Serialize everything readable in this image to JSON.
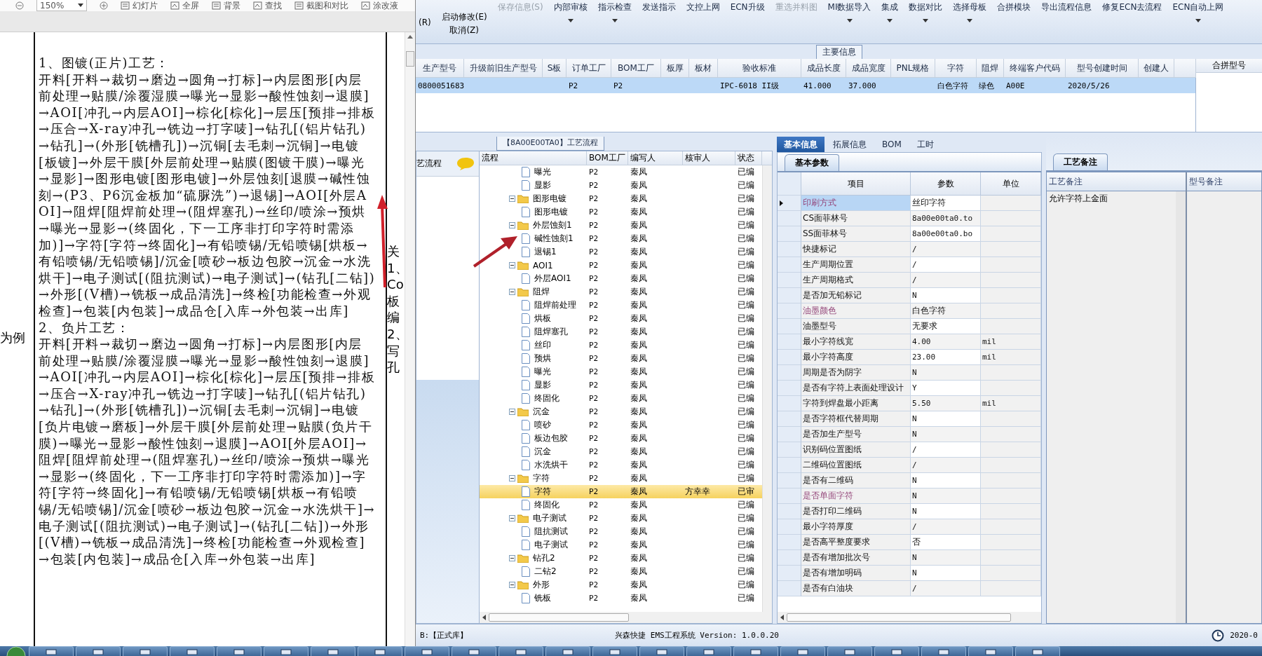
{
  "viewer": {
    "zoom": "150%",
    "tools": [
      "幻灯片",
      "全屏",
      "背景",
      "查找",
      "截图和对比",
      "涂改液"
    ],
    "left_margin": "为例",
    "paragraphs": [
      "1、图镀(正片)工艺：",
      "开料[开料→裁切→磨边→圆角→打标]→内层图形[内层前处理→贴膜/涂覆湿膜→曝光→显影→酸性蚀刻→退膜]→AOI[冲孔→内层AOI]→棕化[棕化]→层压[预排→排板→压合→X-ray冲孔→铣边→打字唛]→钻孔[(铝片钻孔)→钻孔]→(外形[铣槽孔])→沉铜[去毛刺→沉铜]→电镀[板镀]→外层干膜[外层前处理→贴膜(图镀干膜)→曝光→显影]→图形电镀[图形电镀]→外层蚀刻[退膜→碱性蚀刻→(P3、P6沉金板加“硫脲洗”)→退锡]→AOI[外层AOI]→阻焊[阻焊前处理→(阻焊塞孔)→丝印/喷涂→预烘→曝光→显影→(终固化，下一工序非打印字符时需添加)]→字符[字符→终固化]→有铅喷锡/无铅喷锡[烘板→有铅喷锡/无铅喷锡]/沉金[喷砂→板边包胶→沉金→水洗烘干]→电子测试[(阻抗测试)→电子测试]→(钻孔[二钻])→外形[(V槽)→铣板→成品清洗]→终检[功能检查→外观检查]→包装[内包装]→成品仓[入库→外包装→出库]",
      "2、负片工艺：",
      "开料[开料→裁切→磨边→圆角→打标]→内层图形[内层前处理→贴膜/涂覆湿膜→曝光→显影→酸性蚀刻→退膜]→AOI[冲孔→内层AOI]→棕化[棕化]→层压[预排→排板→压合→X-ray冲孔→铣边→打字唛]→钻孔[(铝片钻孔)→钻孔]→(外形[铣槽孔])→沉铜[去毛刺→沉铜]→电镀[负片电镀→磨板]→外层干膜[外层前处理→贴膜(负片干膜)→曝光→显影→酸性蚀刻→退膜]→AOI[外层AOI]→阻焊[阻焊前处理→(阻焊塞孔)→丝印/喷涂→预烘→曝光→显影→(终固化，下一工序非打印字符时需添加)]→字符[字符→终固化]→有铅喷锡/无铅喷锡[烘板→有铅喷锡/无铅喷锡]/沉金[喷砂→板边包胶→沉金→水洗烘干]→电子测试[(阻抗测试)→电子测试]→(钻孔[二钻])→外形[(V槽)→铣板→成品清洗]→终检[功能检查→外观检查]→包装[内包装]→成品仓[入库→外包装→出库]"
    ],
    "right_margin": [
      "关",
      "1、",
      "Co",
      "板",
      "编",
      "2、",
      "写",
      "孔"
    ]
  },
  "ribbon": {
    "left": "(R)",
    "stacked": [
      "启动修改(E)",
      "取消(Z)"
    ],
    "buttons": [
      {
        "label": "保存信息(S)",
        "disabled": true,
        "dropdown": false
      },
      {
        "label": "内部审核",
        "disabled": false,
        "dropdown": true
      },
      {
        "label": "指示检查",
        "disabled": false,
        "dropdown": true
      },
      {
        "label": "发送指示",
        "disabled": false,
        "dropdown": false
      },
      {
        "label": "文控上网",
        "disabled": false,
        "dropdown": false
      },
      {
        "label": "ECN升级",
        "disabled": false,
        "dropdown": false
      },
      {
        "label": "重选并料图",
        "disabled": true,
        "dropdown": false
      },
      {
        "label": "MI数据导入",
        "disabled": false,
        "dropdown": true
      },
      {
        "label": "集成",
        "disabled": false,
        "dropdown": true
      },
      {
        "label": "数据对比",
        "disabled": false,
        "dropdown": true
      },
      {
        "label": "选择母板",
        "disabled": false,
        "dropdown": true
      },
      {
        "label": "合拼模块",
        "disabled": false,
        "dropdown": false
      },
      {
        "label": "导出流程信息",
        "disabled": false,
        "dropdown": false
      },
      {
        "label": "修复ECN去流程",
        "disabled": false,
        "dropdown": false
      },
      {
        "label": "ECN自动上网",
        "disabled": false,
        "dropdown": true
      }
    ]
  },
  "main_info": {
    "title": "主要信息",
    "columns": [
      "生产型号",
      "升级前旧生产型号",
      "S板",
      "订单工厂",
      "BOM工厂",
      "板厚",
      "板材",
      "验收标准",
      "成品长度",
      "成品宽度",
      "PNL规格",
      "字符",
      "阻焊",
      "终端客户代码",
      "型号创建时间",
      "创建人"
    ],
    "rows": [
      {
        "selected": true,
        "cells": [
          "0800051683",
          "",
          "",
          "P2",
          "P2",
          "",
          "",
          "IPC-6018 II级",
          "41.000",
          "37.000",
          "",
          "白色字符",
          "绿色",
          "A00E",
          "2020/5/26",
          ""
        ]
      }
    ],
    "side_column": "合拼型号"
  },
  "flow": {
    "title": "【8A00E00TA0】工艺流程",
    "side_label": "艺流程",
    "columns": [
      "流程",
      "BOM工厂",
      "编写人",
      "核审人",
      "状态"
    ],
    "nodes": [
      {
        "kind": "file",
        "label": "曝光",
        "bom": "P2",
        "writer": "秦凤",
        "status": "已编",
        "selected": false
      },
      {
        "kind": "file",
        "label": "显影",
        "bom": "P2",
        "writer": "秦凤",
        "status": "已编",
        "selected": false
      },
      {
        "kind": "folder",
        "label": "图形电镀",
        "bom": "P2",
        "writer": "秦凤",
        "status": "已编",
        "selected": false,
        "expanded": true,
        "children": [
          {
            "kind": "file",
            "label": "图形电镀",
            "bom": "P2",
            "writer": "秦凤",
            "status": "已编",
            "selected": false
          }
        ]
      },
      {
        "kind": "folder",
        "label": "外层蚀刻1",
        "bom": "P2",
        "writer": "秦凤",
        "status": "已编",
        "selected": false,
        "expanded": true,
        "children": [
          {
            "kind": "file",
            "label": "碱性蚀刻1",
            "bom": "P2",
            "writer": "秦凤",
            "status": "已编",
            "selected": false
          },
          {
            "kind": "file",
            "label": "退锡1",
            "bom": "P2",
            "writer": "秦凤",
            "status": "已编",
            "selected": false
          }
        ]
      },
      {
        "kind": "folder",
        "label": "AOI1",
        "bom": "P2",
        "writer": "秦凤",
        "status": "已编",
        "selected": false,
        "expanded": true,
        "children": [
          {
            "kind": "file",
            "label": "外层AOI1",
            "bom": "P2",
            "writer": "秦凤",
            "status": "已编",
            "selected": false
          }
        ]
      },
      {
        "kind": "folder",
        "label": "阻焊",
        "bom": "P2",
        "writer": "秦凤",
        "status": "已编",
        "selected": false,
        "expanded": true,
        "children": [
          {
            "kind": "file",
            "label": "阻焊前处理",
            "bom": "P2",
            "writer": "秦凤",
            "status": "已编",
            "selected": false
          },
          {
            "kind": "file",
            "label": "烘板",
            "bom": "P2",
            "writer": "秦凤",
            "status": "已编",
            "selected": false
          },
          {
            "kind": "file",
            "label": "阻焊塞孔",
            "bom": "P2",
            "writer": "秦凤",
            "status": "已编",
            "selected": false
          },
          {
            "kind": "file",
            "label": "丝印",
            "bom": "P2",
            "writer": "秦凤",
            "status": "已编",
            "selected": false
          },
          {
            "kind": "file",
            "label": "预烘",
            "bom": "P2",
            "writer": "秦凤",
            "status": "已编",
            "selected": false
          },
          {
            "kind": "file",
            "label": "曝光",
            "bom": "P2",
            "writer": "秦凤",
            "status": "已编",
            "selected": false
          },
          {
            "kind": "file",
            "label": "显影",
            "bom": "P2",
            "writer": "秦凤",
            "status": "已编",
            "selected": false
          },
          {
            "kind": "file",
            "label": "终固化",
            "bom": "P2",
            "writer": "秦凤",
            "status": "已编",
            "selected": false
          }
        ]
      },
      {
        "kind": "folder",
        "label": "沉金",
        "bom": "P2",
        "writer": "秦凤",
        "status": "已编",
        "selected": false,
        "expanded": true,
        "children": [
          {
            "kind": "file",
            "label": "喷砂",
            "bom": "P2",
            "writer": "秦凤",
            "status": "已编",
            "selected": false
          },
          {
            "kind": "file",
            "label": "板边包胶",
            "bom": "P2",
            "writer": "秦凤",
            "status": "已编",
            "selected": false
          },
          {
            "kind": "file",
            "label": "沉金",
            "bom": "P2",
            "writer": "秦凤",
            "status": "已编",
            "selected": false
          },
          {
            "kind": "file",
            "label": "水洗烘干",
            "bom": "P2",
            "writer": "秦凤",
            "status": "已编",
            "selected": false
          }
        ]
      },
      {
        "kind": "folder",
        "label": "字符",
        "bom": "P2",
        "writer": "秦凤",
        "status": "已编",
        "selected": false,
        "expanded": true,
        "children": [
          {
            "kind": "file",
            "label": "字符",
            "bom": "P2",
            "writer": "秦凤",
            "reviewer": "方幸幸",
            "status": "已审",
            "selected": true
          },
          {
            "kind": "file",
            "label": "终固化",
            "bom": "P2",
            "writer": "秦凤",
            "status": "已编",
            "selected": false
          }
        ]
      },
      {
        "kind": "folder",
        "label": "电子测试",
        "bom": "P2",
        "writer": "秦凤",
        "status": "已编",
        "selected": false,
        "expanded": true,
        "children": [
          {
            "kind": "file",
            "label": "阻抗测试",
            "bom": "P2",
            "writer": "秦凤",
            "status": "已编",
            "selected": false
          },
          {
            "kind": "file",
            "label": "电子测试",
            "bom": "P2",
            "writer": "秦凤",
            "status": "已编",
            "selected": false
          }
        ]
      },
      {
        "kind": "folder",
        "label": "钻孔2",
        "bom": "P2",
        "writer": "秦凤",
        "status": "已编",
        "selected": false,
        "expanded": true,
        "children": [
          {
            "kind": "file",
            "label": "二钻2",
            "bom": "P2",
            "writer": "秦凤",
            "status": "已编",
            "selected": false
          }
        ]
      },
      {
        "kind": "folder",
        "label": "外形",
        "bom": "P2",
        "writer": "秦凤",
        "status": "已编",
        "selected": false,
        "expanded": true,
        "children": [
          {
            "kind": "file",
            "label": "铣板",
            "bom": "P2",
            "writer": "秦凤",
            "status": "已编",
            "selected": false
          }
        ]
      }
    ]
  },
  "properties": {
    "tabs": [
      {
        "label": "基本信息",
        "selected": true
      },
      {
        "label": "拓展信息",
        "selected": false
      },
      {
        "label": "BOM",
        "selected": false
      },
      {
        "label": "工时",
        "selected": false
      }
    ],
    "subtab": "基本参数",
    "columns": [
      "项目",
      "参数",
      "单位"
    ],
    "rows": [
      {
        "item": "印刷方式",
        "value": "丝印字符",
        "unit": "",
        "highlight": true,
        "selected": true
      },
      {
        "item": "CS面菲林号",
        "value": "8a00e00ta0.to",
        "unit": "",
        "highlight": false,
        "selected": false
      },
      {
        "item": "SS面菲林号",
        "value": "8a00e00ta0.bo",
        "unit": "",
        "highlight": false,
        "selected": false
      },
      {
        "item": "快捷标记",
        "value": "/",
        "unit": "",
        "highlight": false,
        "selected": false
      },
      {
        "item": "生产周期位置",
        "value": "/",
        "unit": "",
        "highlight": false,
        "selected": false
      },
      {
        "item": "生产周期格式",
        "value": "/",
        "unit": "",
        "highlight": false,
        "selected": false
      },
      {
        "item": "是否加无铅标记",
        "value": "N",
        "unit": "",
        "highlight": false,
        "selected": false
      },
      {
        "item": "油墨颜色",
        "value": "白色字符",
        "unit": "",
        "highlight": true,
        "selected": false
      },
      {
        "item": "油墨型号",
        "value": "无要求",
        "unit": "",
        "highlight": false,
        "selected": false
      },
      {
        "item": "最小字符线宽",
        "value": "4.00",
        "unit": "mil",
        "highlight": false,
        "selected": false
      },
      {
        "item": "最小字符高度",
        "value": "23.00",
        "unit": "mil",
        "highlight": false,
        "selected": false
      },
      {
        "item": "周期是否为阴字",
        "value": "N",
        "unit": "",
        "highlight": false,
        "selected": false
      },
      {
        "item": "是否有字符上表面处理设计",
        "value": "Y",
        "unit": "",
        "highlight": false,
        "selected": false
      },
      {
        "item": "字符到焊盘最小距离",
        "value": "5.50",
        "unit": "mil",
        "highlight": false,
        "selected": false
      },
      {
        "item": "是否字符框代替周期",
        "value": "N",
        "unit": "",
        "highlight": false,
        "selected": false
      },
      {
        "item": "是否加生产型号",
        "value": "N",
        "unit": "",
        "highlight": false,
        "selected": false
      },
      {
        "item": "识别码位置图纸",
        "value": "/",
        "unit": "",
        "highlight": false,
        "selected": false
      },
      {
        "item": "二维码位置图纸",
        "value": "/",
        "unit": "",
        "highlight": false,
        "selected": false
      },
      {
        "item": "是否有二维码",
        "value": "N",
        "unit": "",
        "highlight": false,
        "selected": false
      },
      {
        "item": "是否单面字符",
        "value": "N",
        "unit": "",
        "highlight": true,
        "selected": false
      },
      {
        "item": "是否打印二维码",
        "value": "N",
        "unit": "",
        "highlight": false,
        "selected": false
      },
      {
        "item": "最小字符厚度",
        "value": "/",
        "unit": "",
        "highlight": false,
        "selected": false
      },
      {
        "item": "是否高平整度要求",
        "value": "否",
        "unit": "",
        "highlight": false,
        "selected": false
      },
      {
        "item": "是否有增加批次号",
        "value": "N",
        "unit": "",
        "highlight": false,
        "selected": false
      },
      {
        "item": "是否有增加明码",
        "value": "N",
        "unit": "",
        "highlight": false,
        "selected": false
      },
      {
        "item": "是否有白油块",
        "value": "/",
        "unit": "",
        "highlight": false,
        "selected": false
      }
    ]
  },
  "notes": {
    "tab": "工艺备注",
    "columns": [
      "工艺备注",
      "型号备注"
    ],
    "process_note": "允许字符上金面"
  },
  "status_bar": {
    "database": "B:【正式库】",
    "product": "兴森快捷 EMS工程系统 Version: 1.0.0.20",
    "date": "2020-0"
  }
}
